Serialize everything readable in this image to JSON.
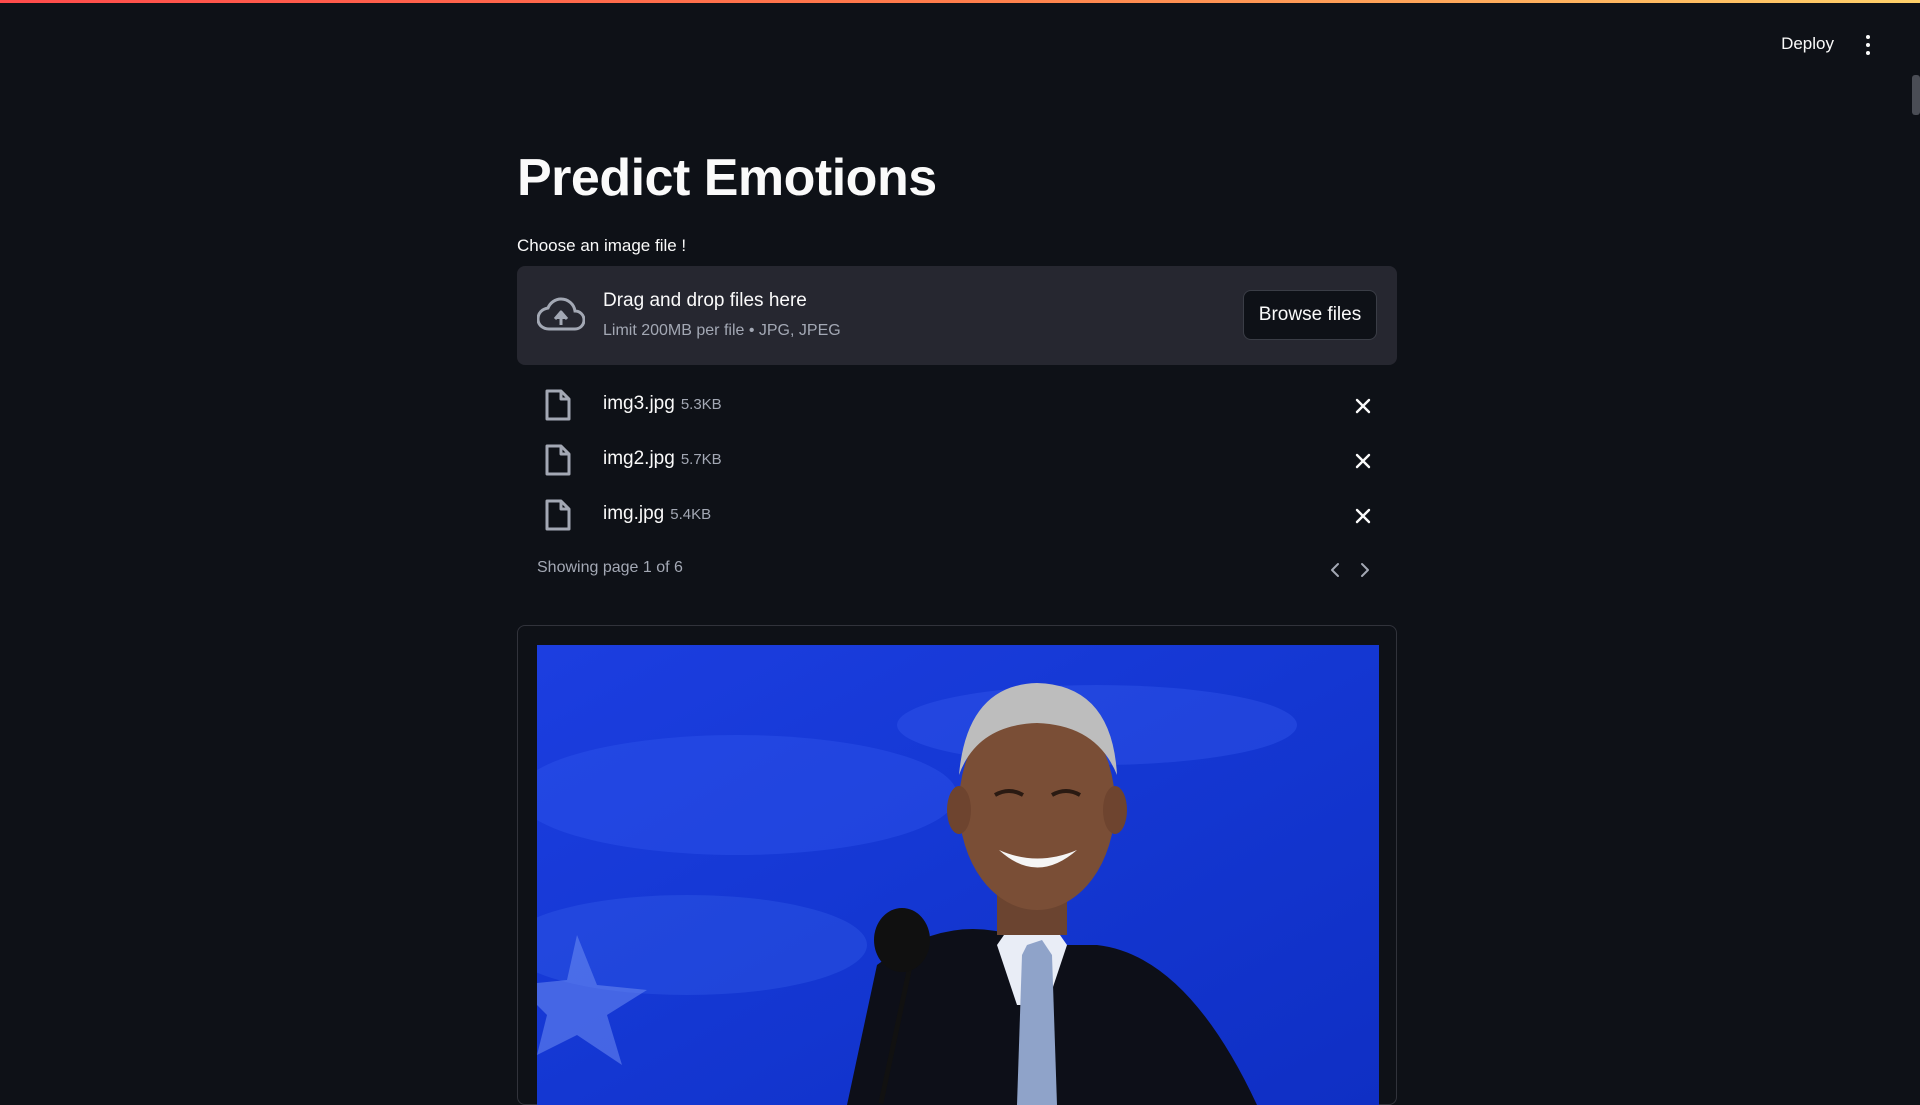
{
  "header": {
    "deploy_label": "Deploy",
    "menu_icon": "kebab-menu-icon"
  },
  "page": {
    "title": "Predict Emotions"
  },
  "uploader": {
    "label": "Choose an image file !",
    "drop_title": "Drag and drop files here",
    "limit_text": "Limit 200MB per file • JPG, JPEG",
    "browse_label": "Browse files",
    "icon": "cloud-upload-icon"
  },
  "files": [
    {
      "name": "img3.jpg",
      "size": "5.3KB"
    },
    {
      "name": "img2.jpg",
      "size": "5.7KB"
    },
    {
      "name": "img.jpg",
      "size": "5.4KB"
    }
  ],
  "pagination": {
    "text": "Showing page 1 of 6"
  },
  "colors": {
    "background": "#0e1117",
    "dropzone": "#262730",
    "accent_gradient_start": "#ff4b4b",
    "accent_gradient_end": "#ffd16a",
    "muted_text": "#a3a8b4"
  }
}
